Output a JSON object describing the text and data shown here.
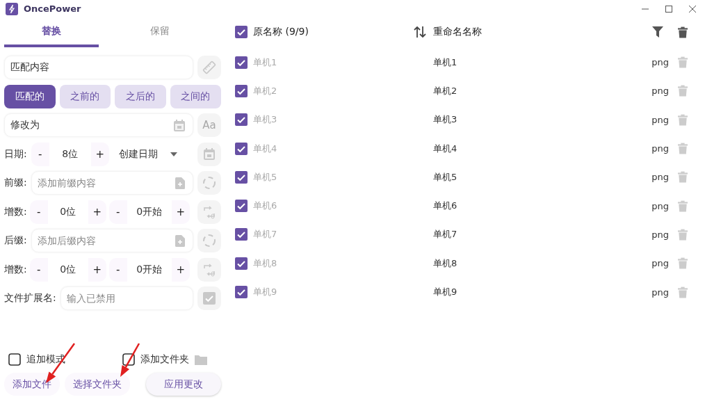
{
  "window": {
    "title": "OncePower"
  },
  "tabs": [
    {
      "label": "替换",
      "selected": true
    },
    {
      "label": "保留",
      "selected": false
    }
  ],
  "match_field": {
    "value": "匹配内容"
  },
  "match_modes": [
    {
      "label": "匹配的",
      "selected": true
    },
    {
      "label": "之前的",
      "selected": false
    },
    {
      "label": "之后的",
      "selected": false
    },
    {
      "label": "之间的",
      "selected": false
    }
  ],
  "replace_field": {
    "value": "修改为",
    "case_button": "Aa"
  },
  "rows": [
    {
      "kind": "date",
      "label": "日期:",
      "minus": "-",
      "value": "8位",
      "plus": "+",
      "dropdown": "创建日期"
    },
    {
      "kind": "text",
      "label": "前缀:",
      "placeholder": "添加前缀内容"
    },
    {
      "kind": "counter",
      "label": "增数:",
      "steppers": [
        {
          "minus": "-",
          "value": "0位",
          "plus": "+"
        },
        {
          "minus": "-",
          "value": "0开始",
          "plus": "+"
        }
      ]
    },
    {
      "kind": "text",
      "label": "后缀:",
      "placeholder": "添加后缀内容"
    },
    {
      "kind": "counter",
      "label": "增数:",
      "steppers": [
        {
          "minus": "-",
          "value": "0位",
          "plus": "+"
        },
        {
          "minus": "-",
          "value": "0开始",
          "plus": "+"
        }
      ]
    },
    {
      "kind": "ext",
      "label": "文件扩展名:",
      "placeholder": "输入已禁用"
    }
  ],
  "options": [
    {
      "label": "追加模式",
      "checked": false
    },
    {
      "label": "添加文件夹",
      "checked": false
    }
  ],
  "actions": [
    {
      "label": "添加文件"
    },
    {
      "label": "选择文件夹"
    },
    {
      "label": "应用更改"
    }
  ],
  "table": {
    "select_all": true,
    "columns": [
      "原名称 (9/9)",
      "重命名名称"
    ],
    "rows": [
      {
        "checked": true,
        "original": "单机1",
        "renamed": "单机1",
        "ext": "png"
      },
      {
        "checked": true,
        "original": "单机2",
        "renamed": "单机2",
        "ext": "png"
      },
      {
        "checked": true,
        "original": "单机3",
        "renamed": "单机3",
        "ext": "png"
      },
      {
        "checked": true,
        "original": "单机4",
        "renamed": "单机4",
        "ext": "png"
      },
      {
        "checked": true,
        "original": "单机5",
        "renamed": "单机5",
        "ext": "png"
      },
      {
        "checked": true,
        "original": "单机6",
        "renamed": "单机6",
        "ext": "png"
      },
      {
        "checked": true,
        "original": "单机7",
        "renamed": "单机7",
        "ext": "png"
      },
      {
        "checked": true,
        "original": "单机8",
        "renamed": "单机8",
        "ext": "png"
      },
      {
        "checked": true,
        "original": "单机9",
        "renamed": "单机9",
        "ext": "png"
      }
    ]
  }
}
